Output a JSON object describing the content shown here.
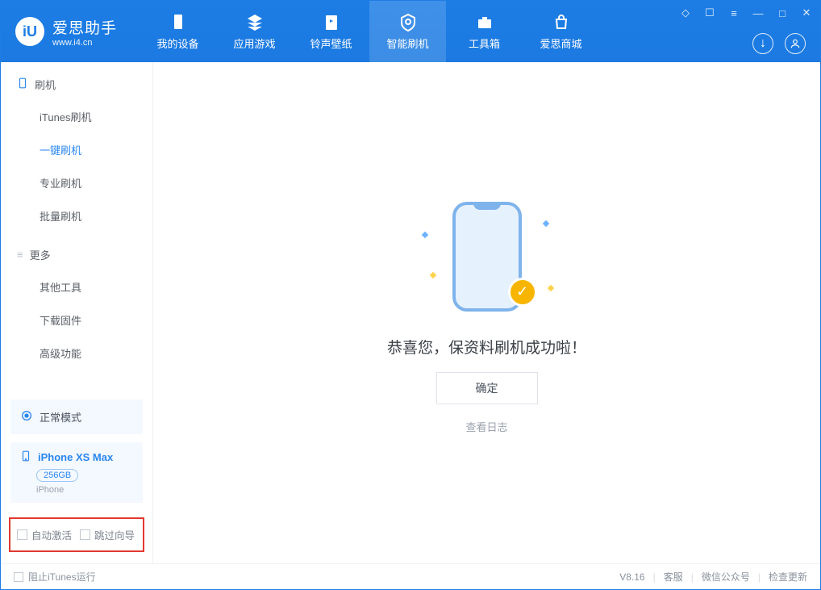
{
  "brand": {
    "name": "爱思助手",
    "sub": "www.i4.cn"
  },
  "tabs": [
    {
      "label": "我的设备",
      "name": "tab-device"
    },
    {
      "label": "应用游戏",
      "name": "tab-apps"
    },
    {
      "label": "铃声壁纸",
      "name": "tab-ring"
    },
    {
      "label": "智能刷机",
      "name": "tab-flash",
      "active": true
    },
    {
      "label": "工具箱",
      "name": "tab-tools"
    },
    {
      "label": "爱思商城",
      "name": "tab-store"
    }
  ],
  "sidebar": {
    "section1": "刷机",
    "items1": [
      "iTunes刷机",
      "一键刷机",
      "专业刷机",
      "批量刷机"
    ],
    "activeItem": "一键刷机",
    "section2": "更多",
    "items2": [
      "其他工具",
      "下载固件",
      "高级功能"
    ]
  },
  "mode": {
    "label": "正常模式"
  },
  "device": {
    "name": "iPhone XS Max",
    "storage": "256GB",
    "type": "iPhone"
  },
  "checks": {
    "auto_activate": "自动激活",
    "skip_guide": "跳过向导"
  },
  "main": {
    "message": "恭喜您，保资料刷机成功啦！",
    "ok": "确定",
    "log": "查看日志"
  },
  "status": {
    "block_itunes": "阻止iTunes运行",
    "version": "V8.16",
    "service": "客服",
    "wechat": "微信公众号",
    "update": "检查更新"
  }
}
